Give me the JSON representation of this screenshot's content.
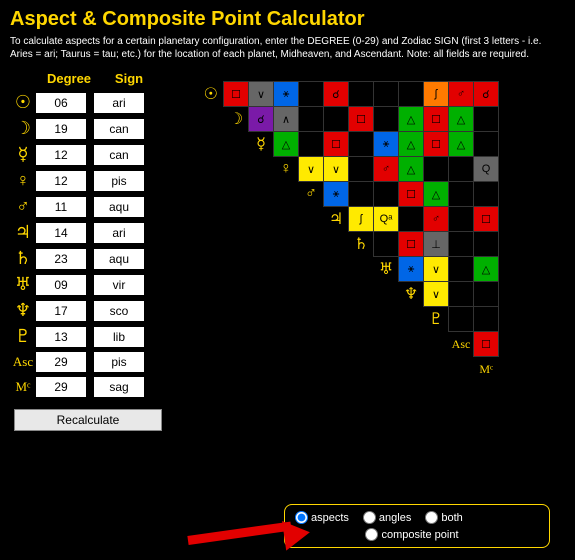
{
  "title": "Aspect & Composite Point Calculator",
  "instructions": "To calculate aspects for a certain planetary configuration, enter the DEGREE (0-29) and Zodiac SIGN (first 3 letters - i.e. Aries = ari; Taurus = tau; etc.) for the location of each planet, Midheaven, and Ascendant. Note: all fields are required.",
  "headers": {
    "degree": "Degree",
    "sign": "Sign"
  },
  "planets": [
    {
      "glyph": "☉",
      "deg": "06",
      "sign": "ari",
      "name": "sun"
    },
    {
      "glyph": "☽",
      "deg": "19",
      "sign": "can",
      "name": "moon"
    },
    {
      "glyph": "☿",
      "deg": "12",
      "sign": "can",
      "name": "mercury"
    },
    {
      "glyph": "♀",
      "deg": "12",
      "sign": "pis",
      "name": "venus"
    },
    {
      "glyph": "♂",
      "deg": "11",
      "sign": "aqu",
      "name": "mars"
    },
    {
      "glyph": "♃",
      "deg": "14",
      "sign": "ari",
      "name": "jupiter"
    },
    {
      "glyph": "♄",
      "deg": "23",
      "sign": "aqu",
      "name": "saturn"
    },
    {
      "glyph": "♅",
      "deg": "09",
      "sign": "vir",
      "name": "uranus"
    },
    {
      "glyph": "♆",
      "deg": "17",
      "sign": "sco",
      "name": "neptune"
    },
    {
      "glyph": "♇",
      "deg": "13",
      "sign": "lib",
      "name": "pluto"
    },
    {
      "glyph": "Asc",
      "deg": "29",
      "sign": "pis",
      "name": "ascendant"
    },
    {
      "glyph": "Mᶜ",
      "deg": "29",
      "sign": "sag",
      "name": "midheaven"
    }
  ],
  "recalculate": "Recalculate",
  "options": {
    "aspects": "aspects",
    "angles": "angles",
    "both": "both",
    "composite": "composite point"
  },
  "chart_data": {
    "type": "table",
    "title": "Aspect Grid",
    "row_headers": [
      "☉",
      "☽",
      "☿",
      "♀",
      "♂",
      "♃",
      "♄",
      "♅",
      "♆",
      "♇",
      "Asc",
      "Mᶜ"
    ],
    "col_headers": [
      "☽",
      "☿",
      "♀",
      "♂",
      "♃",
      "♄",
      "♅",
      "♆",
      "♇",
      "Asc",
      "Mᶜ"
    ],
    "legend_colors": {
      "red": "#e20000",
      "purple": "#7a1aa8",
      "gray": "#666",
      "blue": "#0066e6",
      "green": "#00b000",
      "orange": "#ff7a00",
      "yellow": "#ffea00",
      "black": "#000"
    },
    "cells": [
      [
        [
          "☐",
          "red"
        ],
        [
          "∨",
          "gray"
        ],
        [
          "⚹",
          "blue"
        ],
        [
          "",
          "black"
        ],
        [
          "☌",
          "red"
        ],
        [
          "",
          "black"
        ],
        [
          "",
          "black"
        ],
        [
          "",
          "black"
        ],
        [
          "ʃ",
          "orange"
        ],
        [
          "♂",
          "red"
        ],
        [
          "☌",
          "red"
        ]
      ],
      [
        [
          "☌",
          "purple"
        ],
        [
          "∧",
          "gray"
        ],
        [
          "",
          "black"
        ],
        [
          "",
          "black"
        ],
        [
          "☐",
          "red"
        ],
        [
          "",
          "black"
        ],
        [
          "△",
          "green"
        ],
        [
          "☐",
          "red"
        ],
        [
          "△",
          "green"
        ],
        [
          "",
          "black"
        ]
      ],
      [
        [
          "△",
          "green"
        ],
        [
          "",
          "black"
        ],
        [
          "☐",
          "red"
        ],
        [
          "",
          "black"
        ],
        [
          "⚹",
          "blue"
        ],
        [
          "△",
          "green"
        ],
        [
          "☐",
          "red"
        ],
        [
          "△",
          "green"
        ],
        [
          "",
          "black"
        ]
      ],
      [
        [
          "∨",
          "yellow"
        ],
        [
          "∨",
          "yellow"
        ],
        [
          "",
          "black"
        ],
        [
          "♂",
          "red"
        ],
        [
          "△",
          "green"
        ],
        [
          "",
          "black"
        ],
        [
          "",
          "black"
        ],
        [
          "Q",
          "gray"
        ]
      ],
      [
        [
          "⚹",
          "blue"
        ],
        [
          "",
          "black"
        ],
        [
          "",
          "black"
        ],
        [
          "☐",
          "red"
        ],
        [
          "△",
          "green"
        ],
        [
          "",
          "black"
        ],
        [
          "",
          "black"
        ]
      ],
      [
        [
          "ʃ",
          "yellow"
        ],
        [
          "Qᵃ",
          "yellow"
        ],
        [
          "",
          "black"
        ],
        [
          "♂",
          "red"
        ],
        [
          "",
          "black"
        ],
        [
          "☐",
          "red"
        ]
      ],
      [
        [
          "",
          "black"
        ],
        [
          "☐",
          "red"
        ],
        [
          "⊥",
          "gray"
        ],
        [
          "",
          "black"
        ],
        [
          "",
          "black"
        ]
      ],
      [
        [
          "⚹",
          "blue"
        ],
        [
          "∨",
          "yellow"
        ],
        [
          "",
          "black"
        ],
        [
          "△",
          "green"
        ]
      ],
      [
        [
          "∨",
          "yellow"
        ],
        [
          "",
          "black"
        ],
        [
          "",
          "black"
        ]
      ],
      [
        [
          "",
          "black"
        ],
        [
          "",
          "black"
        ]
      ],
      [
        [
          "☐",
          "red"
        ]
      ]
    ]
  }
}
